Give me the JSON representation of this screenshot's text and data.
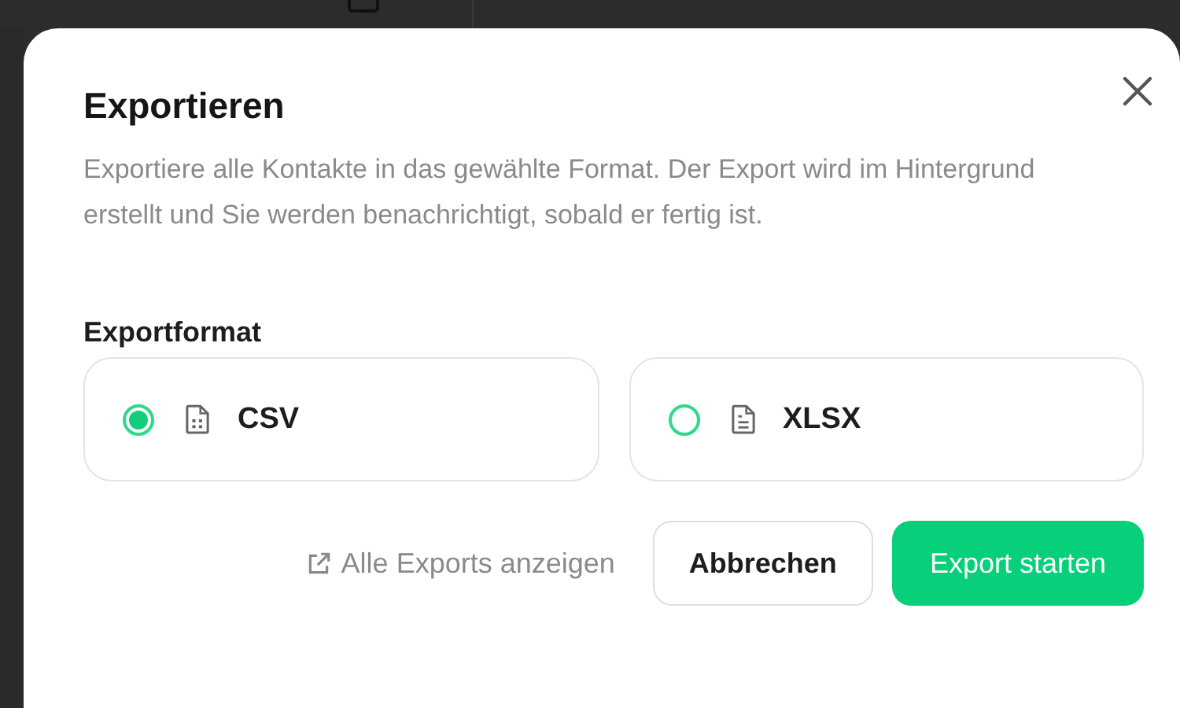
{
  "dialog": {
    "title": "Exportieren",
    "description": "Exportiere alle Kontakte in das gewählte Format. Der Export wird im Hintergrund erstellt und Sie werden benachrichtigt, sobald er fertig ist.",
    "format_label": "Exportformat",
    "formats": [
      {
        "label": "CSV",
        "kind": "table",
        "selected": true
      },
      {
        "label": "XLSX",
        "kind": "text",
        "selected": false
      }
    ],
    "link": "Alle Exports anzeigen",
    "buttons": [
      {
        "label": "Abbrechen",
        "kind": "secondary"
      },
      {
        "label": "Export starten",
        "kind": "primary"
      }
    ]
  }
}
